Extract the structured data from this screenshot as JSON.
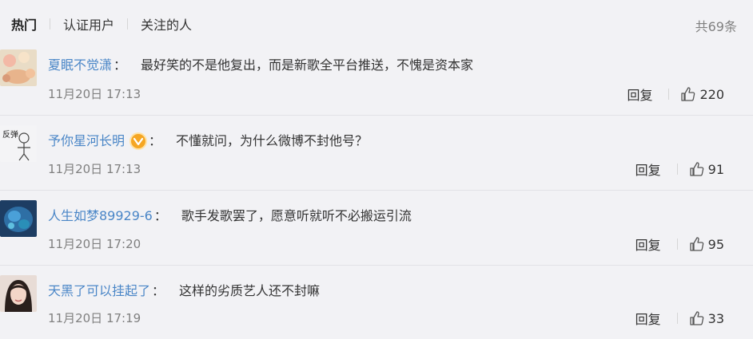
{
  "tabs": [
    {
      "label": "热门",
      "active": true
    },
    {
      "label": "认证用户",
      "active": false
    },
    {
      "label": "关注的人",
      "active": false
    }
  ],
  "total_label": "共69条",
  "reply_label": "回复",
  "colon": "：",
  "comments": [
    {
      "user": "夏眠不觉潇",
      "text": "最好笑的不是他复出，而是新歌全平台推送，不愧是资本家",
      "time": "11月20日 17:13",
      "likes": "220",
      "verified": false
    },
    {
      "user": "予你星河长明",
      "text": "不懂就问，为什么微博不封他号？",
      "time": "11月20日 17:13",
      "likes": "91",
      "verified": true
    },
    {
      "user": "人生如梦89929-6",
      "text": "歌手发歌罢了，愿意听就听不必搬运引流",
      "time": "11月20日 17:20",
      "likes": "95",
      "verified": false
    },
    {
      "user": "天黑了可以挂起了",
      "text": "这样的劣质艺人还不封嘛",
      "time": "11月20日 17:19",
      "likes": "33",
      "verified": false
    }
  ],
  "avatar_texts": {
    "comment2": "反弹"
  },
  "colors": {
    "link": "#4a86c7",
    "bg": "#f2f2f5",
    "muted": "#808080",
    "verified": "#f5a623"
  }
}
